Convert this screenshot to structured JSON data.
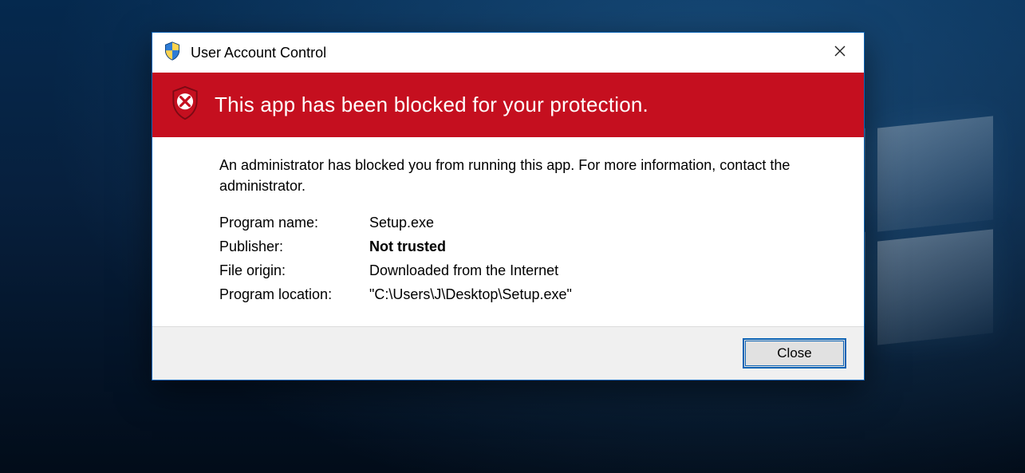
{
  "dialog": {
    "title": "User Account Control",
    "headline": "This app has been blocked for your protection.",
    "message": "An administrator has blocked you from running this app. For more information, contact the administrator.",
    "fields": {
      "program_name_label": "Program name:",
      "program_name_value": "Setup.exe",
      "publisher_label": "Publisher:",
      "publisher_value": "Not trusted",
      "file_origin_label": "File origin:",
      "file_origin_value": "Downloaded from the Internet",
      "program_location_label": "Program location:",
      "program_location_value": "\"C:\\Users\\J\\Desktop\\Setup.exe\""
    },
    "buttons": {
      "close": "Close"
    }
  }
}
